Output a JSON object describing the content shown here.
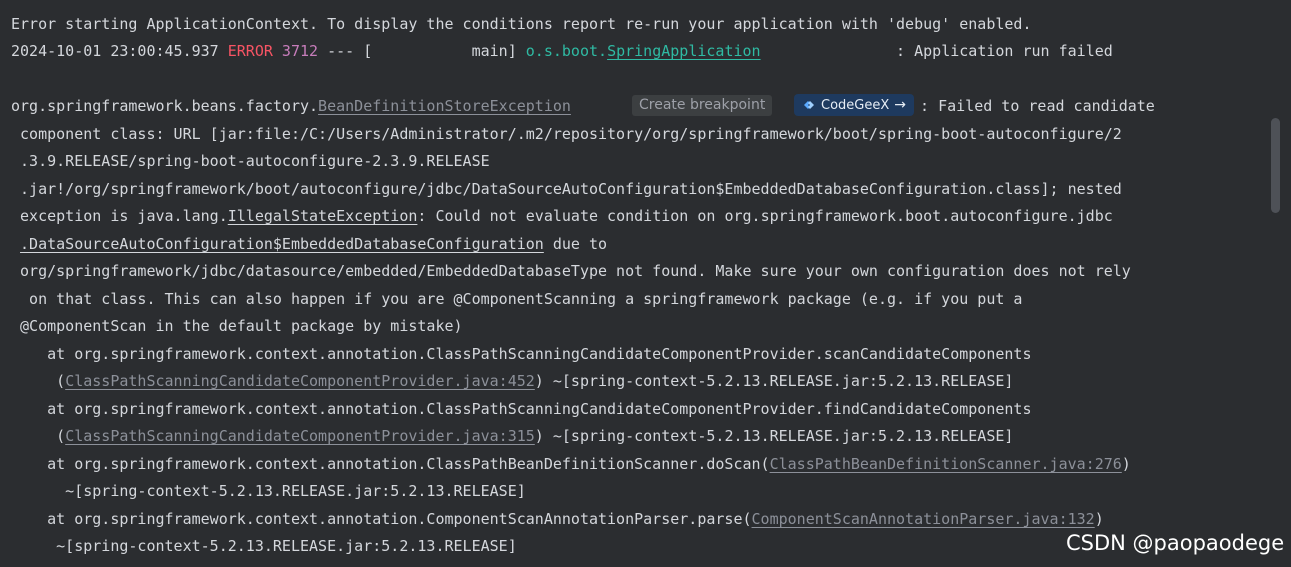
{
  "console": {
    "line1": "Error starting ApplicationContext. To display the conditions report re-run your application with 'debug' enabled.",
    "line2": {
      "timestamp": "2024-10-01 23:00:45.937 ",
      "level": "ERROR",
      "pid": " 3712",
      "sep": " --- [           main] ",
      "logger_prefix": "o.s.boot.",
      "logger_link": "SpringApplication",
      "message": "               : Application run failed"
    },
    "exception": {
      "pkg": "org.springframework.beans.factory.",
      "class_link": "BeanDefinitionStoreException",
      "tail": " : Failed to read candidate"
    },
    "wrap1": " component class: URL [jar:file:/C:/Users/Administrator/.m2/repository/org/springframework/boot/spring-boot-autoconfigure/2",
    "wrap2": " .3.9.RELEASE/spring-boot-autoconfigure-2.3.9.RELEASE",
    "wrap3": " .jar!/org/springframework/boot/autoconfigure/jdbc/DataSourceAutoConfiguration$EmbeddedDatabaseConfiguration.class]; nested",
    "wrap4": {
      "pre": " exception is java.lang.",
      "link": "IllegalStateException",
      "post": ": Could not evaluate condition on org.springframework.boot.autoconfigure.jdbc"
    },
    "wrap5": {
      "pre": " ",
      "link": ".DataSourceAutoConfiguration$EmbeddedDatabaseConfiguration",
      "post": " due to"
    },
    "wrap6": " org/springframework/jdbc/datasource/embedded/EmbeddedDatabaseType not found. Make sure your own configuration does not rely",
    "wrap7": "  on that class. This can also happen if you are @ComponentScanning a springframework package (e.g. if you put a",
    "wrap8": " @ComponentScan in the default package by mistake)",
    "frames": [
      {
        "at": "    at org.springframework.context.annotation.ClassPathScanningCandidateComponentProvider.scanCandidateComponents",
        "src_pre": "     (",
        "src_link": "ClassPathScanningCandidateComponentProvider.java:452",
        "src_post": ") ~[spring-context-5.2.13.RELEASE.jar:5.2.13.RELEASE]"
      },
      {
        "at": "    at org.springframework.context.annotation.ClassPathScanningCandidateComponentProvider.findCandidateComponents",
        "src_pre": "     (",
        "src_link": "ClassPathScanningCandidateComponentProvider.java:315",
        "src_post": ") ~[spring-context-5.2.13.RELEASE.jar:5.2.13.RELEASE]"
      },
      {
        "at_pre": "    at org.springframework.context.annotation.ClassPathBeanDefinitionScanner.doScan(",
        "at_link": "ClassPathBeanDefinitionScanner.java:276",
        "at_post": ")",
        "cont": "      ~[spring-context-5.2.13.RELEASE.jar:5.2.13.RELEASE]"
      },
      {
        "at_pre": "    at org.springframework.context.annotation.ComponentScanAnnotationParser.parse(",
        "at_link": "ComponentScanAnnotationParser.java:132",
        "at_post": ")",
        "cont": "     ~[spring-context-5.2.13.RELEASE.jar:5.2.13.RELEASE]"
      }
    ]
  },
  "popups": {
    "create_breakpoint": "Create breakpoint",
    "codegeex_label": "CodeGeeX",
    "codegeex_arrow": "→",
    "codegeex_icon": "codegeex-logo-icon"
  },
  "watermark": "CSDN @paopaodege",
  "colors": {
    "background": "#2b2d30",
    "text": "#d4d7dc",
    "error": "#f75464",
    "pid": "#c77dbb",
    "logger": "#2fbaa3",
    "link_dim": "#8c9099",
    "codegeex_bg": "#1e3a5f"
  }
}
